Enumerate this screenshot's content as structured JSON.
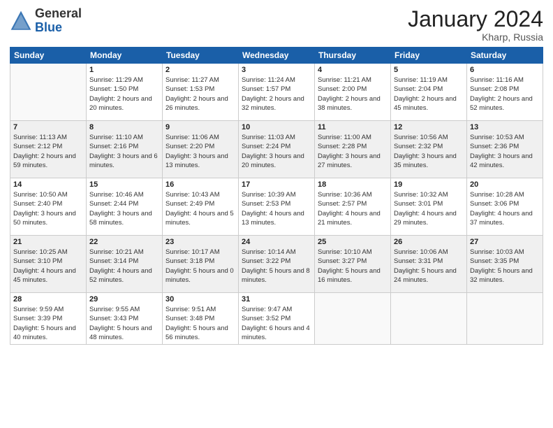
{
  "header": {
    "logo_general": "General",
    "logo_blue": "Blue",
    "month_title": "January 2024",
    "location": "Kharp, Russia"
  },
  "columns": [
    "Sunday",
    "Monday",
    "Tuesday",
    "Wednesday",
    "Thursday",
    "Friday",
    "Saturday"
  ],
  "weeks": [
    [
      {
        "day": "",
        "sunrise": "",
        "sunset": "",
        "daylight": ""
      },
      {
        "day": "1",
        "sunrise": "Sunrise: 11:29 AM",
        "sunset": "Sunset: 1:50 PM",
        "daylight": "Daylight: 2 hours and 20 minutes."
      },
      {
        "day": "2",
        "sunrise": "Sunrise: 11:27 AM",
        "sunset": "Sunset: 1:53 PM",
        "daylight": "Daylight: 2 hours and 26 minutes."
      },
      {
        "day": "3",
        "sunrise": "Sunrise: 11:24 AM",
        "sunset": "Sunset: 1:57 PM",
        "daylight": "Daylight: 2 hours and 32 minutes."
      },
      {
        "day": "4",
        "sunrise": "Sunrise: 11:21 AM",
        "sunset": "Sunset: 2:00 PM",
        "daylight": "Daylight: 2 hours and 38 minutes."
      },
      {
        "day": "5",
        "sunrise": "Sunrise: 11:19 AM",
        "sunset": "Sunset: 2:04 PM",
        "daylight": "Daylight: 2 hours and 45 minutes."
      },
      {
        "day": "6",
        "sunrise": "Sunrise: 11:16 AM",
        "sunset": "Sunset: 2:08 PM",
        "daylight": "Daylight: 2 hours and 52 minutes."
      }
    ],
    [
      {
        "day": "7",
        "sunrise": "Sunrise: 11:13 AM",
        "sunset": "Sunset: 2:12 PM",
        "daylight": "Daylight: 2 hours and 59 minutes."
      },
      {
        "day": "8",
        "sunrise": "Sunrise: 11:10 AM",
        "sunset": "Sunset: 2:16 PM",
        "daylight": "Daylight: 3 hours and 6 minutes."
      },
      {
        "day": "9",
        "sunrise": "Sunrise: 11:06 AM",
        "sunset": "Sunset: 2:20 PM",
        "daylight": "Daylight: 3 hours and 13 minutes."
      },
      {
        "day": "10",
        "sunrise": "Sunrise: 11:03 AM",
        "sunset": "Sunset: 2:24 PM",
        "daylight": "Daylight: 3 hours and 20 minutes."
      },
      {
        "day": "11",
        "sunrise": "Sunrise: 11:00 AM",
        "sunset": "Sunset: 2:28 PM",
        "daylight": "Daylight: 3 hours and 27 minutes."
      },
      {
        "day": "12",
        "sunrise": "Sunrise: 10:56 AM",
        "sunset": "Sunset: 2:32 PM",
        "daylight": "Daylight: 3 hours and 35 minutes."
      },
      {
        "day": "13",
        "sunrise": "Sunrise: 10:53 AM",
        "sunset": "Sunset: 2:36 PM",
        "daylight": "Daylight: 3 hours and 42 minutes."
      }
    ],
    [
      {
        "day": "14",
        "sunrise": "Sunrise: 10:50 AM",
        "sunset": "Sunset: 2:40 PM",
        "daylight": "Daylight: 3 hours and 50 minutes."
      },
      {
        "day": "15",
        "sunrise": "Sunrise: 10:46 AM",
        "sunset": "Sunset: 2:44 PM",
        "daylight": "Daylight: 3 hours and 58 minutes."
      },
      {
        "day": "16",
        "sunrise": "Sunrise: 10:43 AM",
        "sunset": "Sunset: 2:49 PM",
        "daylight": "Daylight: 4 hours and 5 minutes."
      },
      {
        "day": "17",
        "sunrise": "Sunrise: 10:39 AM",
        "sunset": "Sunset: 2:53 PM",
        "daylight": "Daylight: 4 hours and 13 minutes."
      },
      {
        "day": "18",
        "sunrise": "Sunrise: 10:36 AM",
        "sunset": "Sunset: 2:57 PM",
        "daylight": "Daylight: 4 hours and 21 minutes."
      },
      {
        "day": "19",
        "sunrise": "Sunrise: 10:32 AM",
        "sunset": "Sunset: 3:01 PM",
        "daylight": "Daylight: 4 hours and 29 minutes."
      },
      {
        "day": "20",
        "sunrise": "Sunrise: 10:28 AM",
        "sunset": "Sunset: 3:06 PM",
        "daylight": "Daylight: 4 hours and 37 minutes."
      }
    ],
    [
      {
        "day": "21",
        "sunrise": "Sunrise: 10:25 AM",
        "sunset": "Sunset: 3:10 PM",
        "daylight": "Daylight: 4 hours and 45 minutes."
      },
      {
        "day": "22",
        "sunrise": "Sunrise: 10:21 AM",
        "sunset": "Sunset: 3:14 PM",
        "daylight": "Daylight: 4 hours and 52 minutes."
      },
      {
        "day": "23",
        "sunrise": "Sunrise: 10:17 AM",
        "sunset": "Sunset: 3:18 PM",
        "daylight": "Daylight: 5 hours and 0 minutes."
      },
      {
        "day": "24",
        "sunrise": "Sunrise: 10:14 AM",
        "sunset": "Sunset: 3:22 PM",
        "daylight": "Daylight: 5 hours and 8 minutes."
      },
      {
        "day": "25",
        "sunrise": "Sunrise: 10:10 AM",
        "sunset": "Sunset: 3:27 PM",
        "daylight": "Daylight: 5 hours and 16 minutes."
      },
      {
        "day": "26",
        "sunrise": "Sunrise: 10:06 AM",
        "sunset": "Sunset: 3:31 PM",
        "daylight": "Daylight: 5 hours and 24 minutes."
      },
      {
        "day": "27",
        "sunrise": "Sunrise: 10:03 AM",
        "sunset": "Sunset: 3:35 PM",
        "daylight": "Daylight: 5 hours and 32 minutes."
      }
    ],
    [
      {
        "day": "28",
        "sunrise": "Sunrise: 9:59 AM",
        "sunset": "Sunset: 3:39 PM",
        "daylight": "Daylight: 5 hours and 40 minutes."
      },
      {
        "day": "29",
        "sunrise": "Sunrise: 9:55 AM",
        "sunset": "Sunset: 3:43 PM",
        "daylight": "Daylight: 5 hours and 48 minutes."
      },
      {
        "day": "30",
        "sunrise": "Sunrise: 9:51 AM",
        "sunset": "Sunset: 3:48 PM",
        "daylight": "Daylight: 5 hours and 56 minutes."
      },
      {
        "day": "31",
        "sunrise": "Sunrise: 9:47 AM",
        "sunset": "Sunset: 3:52 PM",
        "daylight": "Daylight: 6 hours and 4 minutes."
      },
      {
        "day": "",
        "sunrise": "",
        "sunset": "",
        "daylight": ""
      },
      {
        "day": "",
        "sunrise": "",
        "sunset": "",
        "daylight": ""
      },
      {
        "day": "",
        "sunrise": "",
        "sunset": "",
        "daylight": ""
      }
    ]
  ]
}
